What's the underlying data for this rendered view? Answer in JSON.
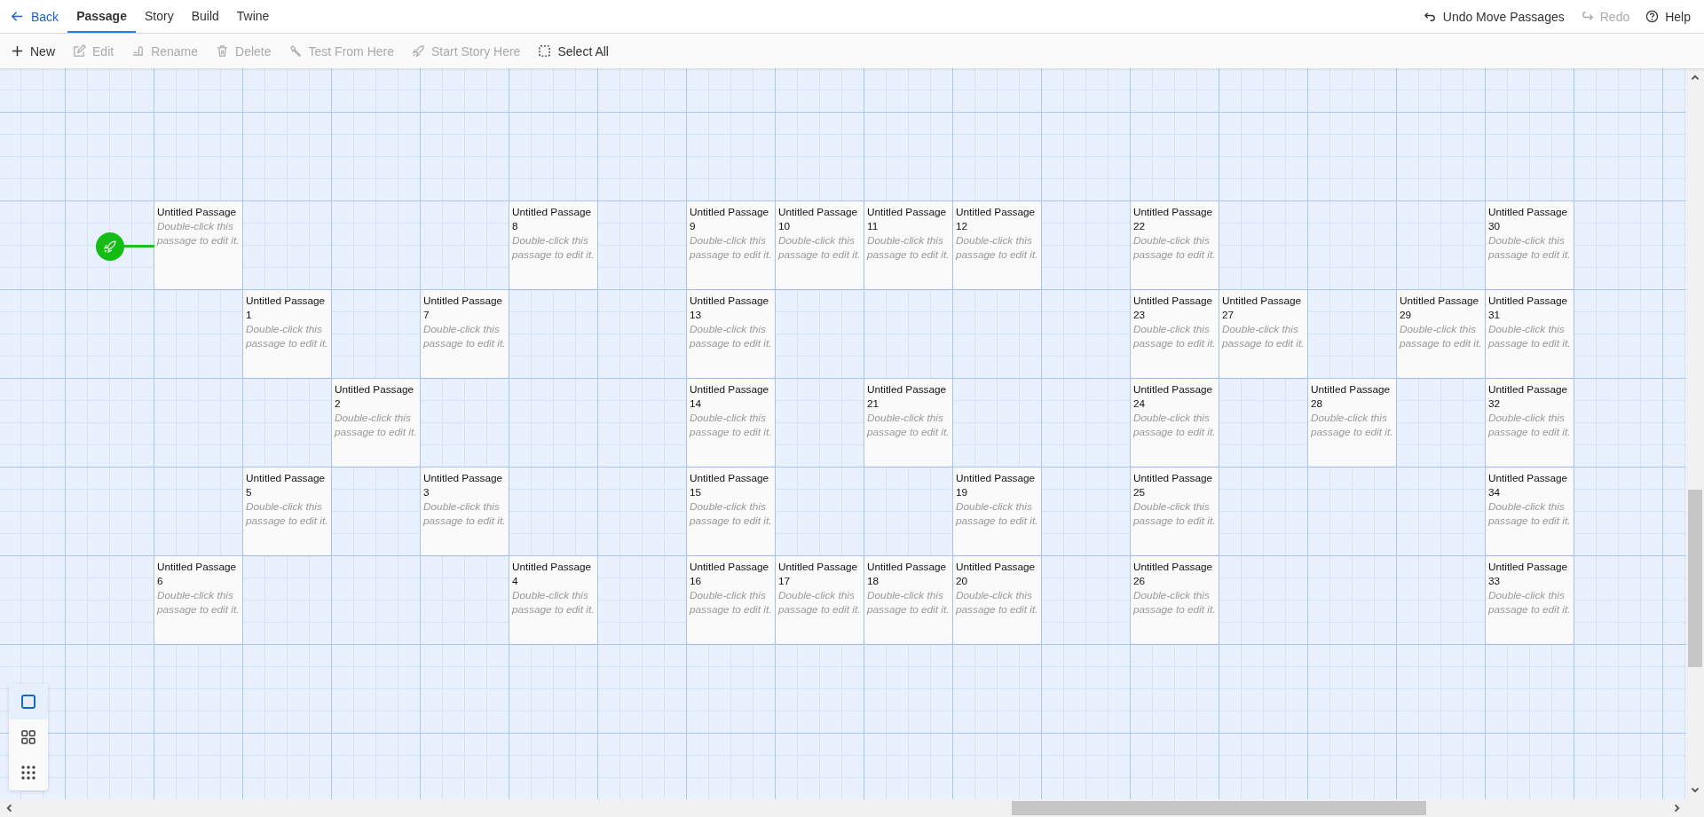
{
  "top_bar": {
    "back": {
      "label": "Back"
    },
    "tabs": [
      {
        "label": "Passage",
        "selected": true
      },
      {
        "label": "Story",
        "selected": false
      },
      {
        "label": "Build",
        "selected": false
      },
      {
        "label": "Twine",
        "selected": false
      }
    ],
    "right_actions": [
      {
        "kind": "undo",
        "label": "Undo Move Passages",
        "disabled": false
      },
      {
        "kind": "redo",
        "label": "Redo",
        "disabled": true
      },
      {
        "kind": "help",
        "label": "Help",
        "disabled": false
      }
    ]
  },
  "toolbar": [
    {
      "kind": "new",
      "label": "New",
      "disabled": false
    },
    {
      "kind": "edit",
      "label": "Edit",
      "disabled": true
    },
    {
      "kind": "rename",
      "label": "Rename",
      "disabled": true
    },
    {
      "kind": "delete",
      "label": "Delete",
      "disabled": true
    },
    {
      "kind": "test",
      "label": "Test From Here",
      "disabled": true
    },
    {
      "kind": "start",
      "label": "Start Story Here",
      "disabled": true
    },
    {
      "kind": "select_all",
      "label": "Select All",
      "disabled": false
    }
  ],
  "story_map": {
    "rows": [
      [
        {
          "kind": "passage",
          "title": "Untitled Passage",
          "excerpt": "Double-click this passage to edit it.",
          "start": true
        },
        {
          "kind": "empty"
        },
        {
          "kind": "empty"
        },
        {
          "kind": "empty"
        },
        {
          "kind": "passage",
          "title": "Untitled Passage 8",
          "excerpt": "Double-click this passage to edit it.",
          "start": false
        },
        {
          "kind": "empty"
        },
        {
          "kind": "passage",
          "title": "Untitled Passage 9",
          "excerpt": "Double-click this passage to edit it.",
          "start": false
        },
        {
          "kind": "passage",
          "title": "Untitled Passage 10",
          "excerpt": "Double-click this passage to edit it.",
          "start": false
        },
        {
          "kind": "passage",
          "title": "Untitled Passage 11",
          "excerpt": "Double-click this passage to edit it.",
          "start": false
        },
        {
          "kind": "passage",
          "title": "Untitled Passage 12",
          "excerpt": "Double-click this passage to edit it.",
          "start": false
        },
        {
          "kind": "empty"
        },
        {
          "kind": "passage",
          "title": "Untitled Passage 22",
          "excerpt": "Double-click this passage to edit it.",
          "start": false
        },
        {
          "kind": "empty"
        },
        {
          "kind": "empty"
        },
        {
          "kind": "empty"
        },
        {
          "kind": "passage",
          "title": "Untitled Passage 30",
          "excerpt": "Double-click this passage to edit it.",
          "start": false
        }
      ],
      [
        {
          "kind": "empty"
        },
        {
          "kind": "passage",
          "title": "Untitled Passage 1",
          "excerpt": "Double-click this passage to edit it.",
          "start": false
        },
        {
          "kind": "empty"
        },
        {
          "kind": "passage",
          "title": "Untitled Passage 7",
          "excerpt": "Double-click this passage to edit it.",
          "start": false
        },
        {
          "kind": "empty"
        },
        {
          "kind": "empty"
        },
        {
          "kind": "passage",
          "title": "Untitled Passage 13",
          "excerpt": "Double-click this passage to edit it.",
          "start": false
        },
        {
          "kind": "empty"
        },
        {
          "kind": "empty"
        },
        {
          "kind": "empty"
        },
        {
          "kind": "empty"
        },
        {
          "kind": "passage",
          "title": "Untitled Passage 23",
          "excerpt": "Double-click this passage to edit it.",
          "start": false
        },
        {
          "kind": "passage",
          "title": "Untitled Passage 27",
          "excerpt": "Double-click this passage to edit it.",
          "start": false
        },
        {
          "kind": "empty"
        },
        {
          "kind": "passage",
          "title": "Untitled Passage 29",
          "excerpt": "Double-click this passage to edit it.",
          "start": false
        },
        {
          "kind": "passage",
          "title": "Untitled Passage 31",
          "excerpt": "Double-click this passage to edit it.",
          "start": false
        }
      ],
      [
        {
          "kind": "empty"
        },
        {
          "kind": "empty"
        },
        {
          "kind": "passage",
          "title": "Untitled Passage 2",
          "excerpt": "Double-click this passage to edit it.",
          "start": false
        },
        {
          "kind": "empty"
        },
        {
          "kind": "empty"
        },
        {
          "kind": "empty"
        },
        {
          "kind": "passage",
          "title": "Untitled Passage 14",
          "excerpt": "Double-click this passage to edit it.",
          "start": false
        },
        {
          "kind": "empty"
        },
        {
          "kind": "passage",
          "title": "Untitled Passage 21",
          "excerpt": "Double-click this passage to edit it.",
          "start": false
        },
        {
          "kind": "empty"
        },
        {
          "kind": "empty"
        },
        {
          "kind": "passage",
          "title": "Untitled Passage 24",
          "excerpt": "Double-click this passage to edit it.",
          "start": false
        },
        {
          "kind": "empty"
        },
        {
          "kind": "passage",
          "title": "Untitled Passage 28",
          "excerpt": "Double-click this passage to edit it.",
          "start": false
        },
        {
          "kind": "empty"
        },
        {
          "kind": "passage",
          "title": "Untitled Passage 32",
          "excerpt": "Double-click this passage to edit it.",
          "start": false
        }
      ],
      [
        {
          "kind": "empty"
        },
        {
          "kind": "passage",
          "title": "Untitled Passage 5",
          "excerpt": "Double-click this passage to edit it.",
          "start": false
        },
        {
          "kind": "empty"
        },
        {
          "kind": "passage",
          "title": "Untitled Passage 3",
          "excerpt": "Double-click this passage to edit it.",
          "start": false
        },
        {
          "kind": "empty"
        },
        {
          "kind": "empty"
        },
        {
          "kind": "passage",
          "title": "Untitled Passage 15",
          "excerpt": "Double-click this passage to edit it.",
          "start": false
        },
        {
          "kind": "empty"
        },
        {
          "kind": "empty"
        },
        {
          "kind": "passage",
          "title": "Untitled Passage 19",
          "excerpt": "Double-click this passage to edit it.",
          "start": false
        },
        {
          "kind": "empty"
        },
        {
          "kind": "passage",
          "title": "Untitled Passage 25",
          "excerpt": "Double-click this passage to edit it.",
          "start": false
        },
        {
          "kind": "empty"
        },
        {
          "kind": "empty"
        },
        {
          "kind": "empty"
        },
        {
          "kind": "passage",
          "title": "Untitled Passage 34",
          "excerpt": "Double-click this passage to edit it.",
          "start": false
        }
      ],
      [
        {
          "kind": "passage",
          "title": "Untitled Passage 6",
          "excerpt": "Double-click this passage to edit it.",
          "start": false
        },
        {
          "kind": "empty"
        },
        {
          "kind": "empty"
        },
        {
          "kind": "empty"
        },
        {
          "kind": "passage",
          "title": "Untitled Passage 4",
          "excerpt": "Double-click this passage to edit it.",
          "start": false
        },
        {
          "kind": "empty"
        },
        {
          "kind": "passage",
          "title": "Untitled Passage 16",
          "excerpt": "Double-click this passage to edit it.",
          "start": false
        },
        {
          "kind": "passage",
          "title": "Untitled Passage 17",
          "excerpt": "Double-click this passage to edit it.",
          "start": false
        },
        {
          "kind": "passage",
          "title": "Untitled Passage 18",
          "excerpt": "Double-click this passage to edit it.",
          "start": false
        },
        {
          "kind": "passage",
          "title": "Untitled Passage 20",
          "excerpt": "Double-click this passage to edit it.",
          "start": false
        },
        {
          "kind": "empty"
        },
        {
          "kind": "passage",
          "title": "Untitled Passage 26",
          "excerpt": "Double-click this passage to edit it.",
          "start": false
        },
        {
          "kind": "empty"
        },
        {
          "kind": "empty"
        },
        {
          "kind": "empty"
        },
        {
          "kind": "passage",
          "title": "Untitled Passage 33",
          "excerpt": "Double-click this passage to edit it.",
          "start": false
        }
      ]
    ]
  },
  "zoom_buttons": [
    {
      "kind": "single",
      "selected": true
    },
    {
      "kind": "four",
      "selected": false
    },
    {
      "kind": "nine",
      "selected": false
    }
  ]
}
